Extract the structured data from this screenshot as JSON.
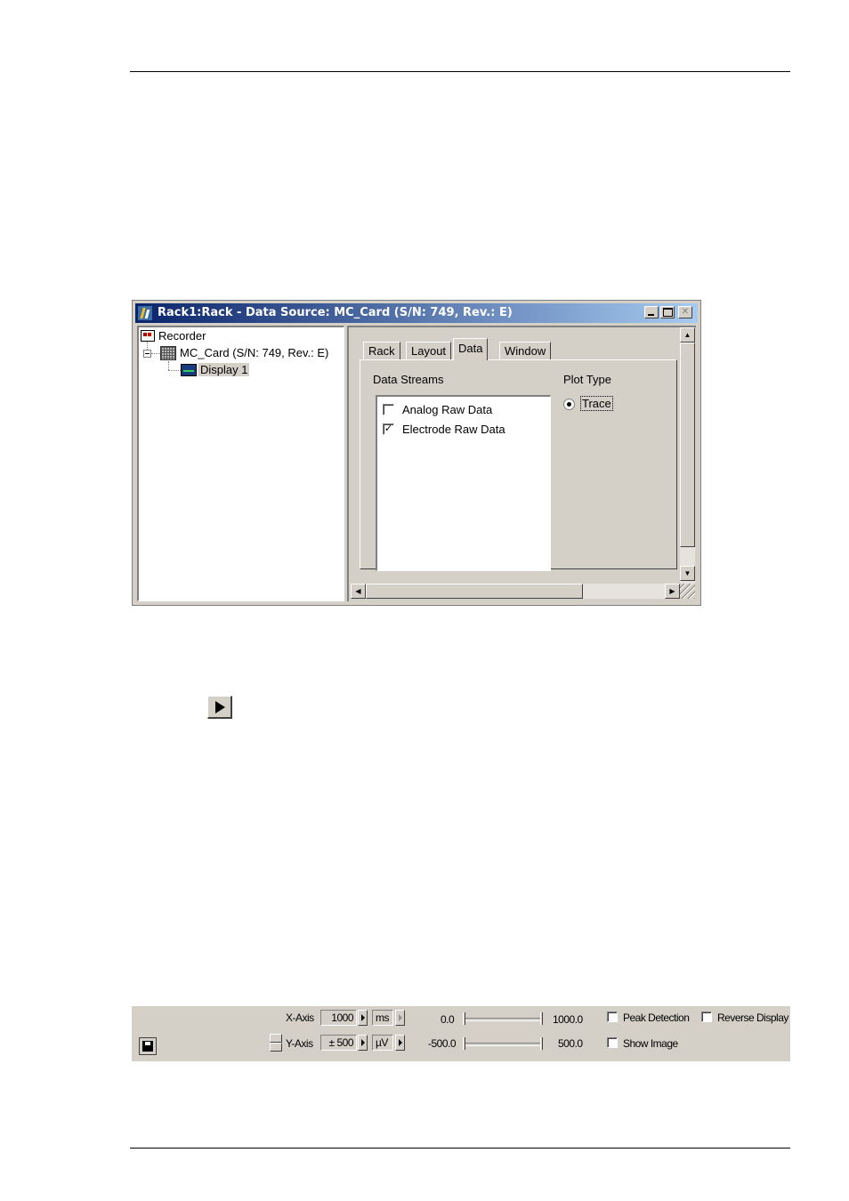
{
  "window": {
    "title": "Rack1:Rack - Data Source: MC_Card (S/N: 749, Rev.: E)",
    "minimize": "_",
    "maximize": "□",
    "close": "✕"
  },
  "tree": {
    "recorder": "Recorder",
    "card": "MC_Card (S/N: 749, Rev.: E)",
    "display": "Display 1"
  },
  "tabs": [
    "Rack",
    "Layout",
    "Data",
    "Window"
  ],
  "active_tab": "Data",
  "data_tab": {
    "streams_label": "Data Streams",
    "streams": [
      {
        "label": "Analog Raw Data",
        "checked": false
      },
      {
        "label": "Electrode Raw Data",
        "checked": true
      }
    ],
    "plot_type_label": "Plot Type",
    "plot_option": "Trace"
  },
  "toolbar": {
    "x_axis_label": "X-Axis",
    "x_value": "1000",
    "x_unit": "ms",
    "x_min": "0.0",
    "x_max": "1000.0",
    "y_axis_label": "Y-Axis",
    "y_value": "± 500",
    "y_unit": "µV",
    "y_min": "-500.0",
    "y_max": "500.0",
    "peak_detection": "Peak Detection",
    "reverse_display": "Reverse Display",
    "show_image": "Show Image"
  },
  "icons": {
    "play": "play-icon",
    "save": "save-icon"
  }
}
